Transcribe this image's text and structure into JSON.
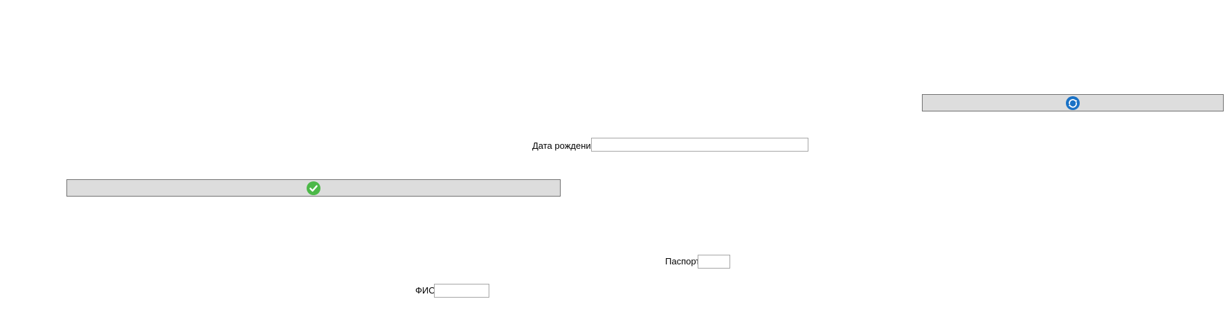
{
  "buttons": {
    "refresh": {
      "icon": "refresh-icon",
      "color": "#1a72c6"
    },
    "confirm": {
      "icon": "checkmark-icon",
      "color": "#4cb848"
    }
  },
  "form": {
    "birth_date": {
      "label": "Дата рождения",
      "value": ""
    },
    "passport": {
      "label": "Паспорт",
      "value": ""
    },
    "full_name": {
      "label": "ФИО",
      "value": ""
    }
  }
}
